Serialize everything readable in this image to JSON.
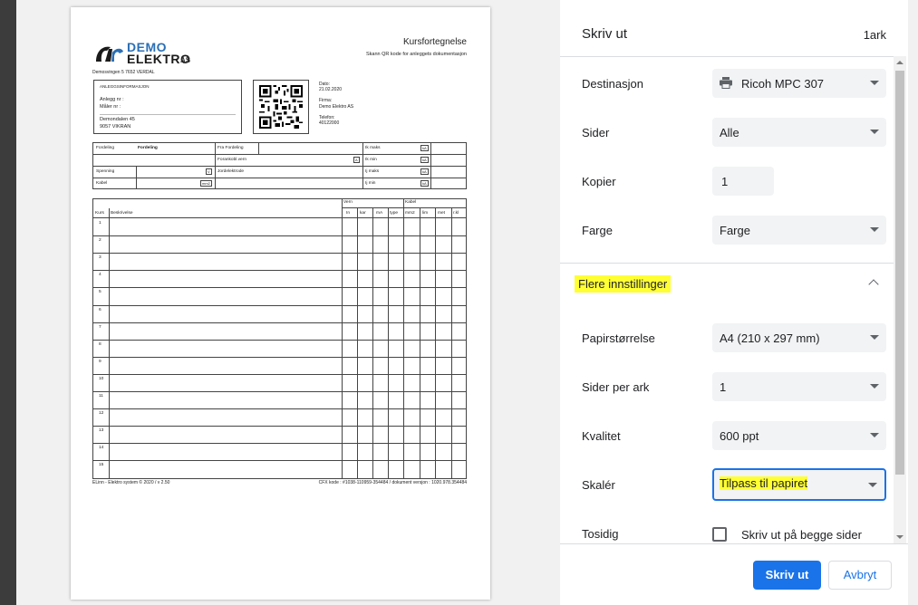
{
  "preview": {
    "company": {
      "line1": "DEMO",
      "line2": "ELEKTRO",
      "suffix": "AS"
    },
    "address": "Demosvingen 5 7652 VERDAL",
    "title": "Kursfortegnelse",
    "subtitle": "Skann QR kode for anleggets dokumentasjon",
    "anlegg": {
      "heading": "ANLEGGSINFORMASJON",
      "anlegg_nr": "Anlegg nr :",
      "maler_nr": "Måler nr :",
      "street": "Demondalen 45",
      "city": "9057 VIKRAN"
    },
    "info": {
      "dato_label": "Dato:",
      "dato": "21.02.2020",
      "firma_label": "Firma:",
      "firma": "Demo Elektro AS",
      "telefon_label": "Telefon:",
      "telefon": "40122000"
    },
    "fordeling": {
      "fordeling_label": "Fordeling",
      "fordeling_value": "Fordeling",
      "fra_fordeling": "Fra Fordeling",
      "forankobl_vern": "Forankobl.vern",
      "spenning": "Spenning",
      "kabel": "Kabel",
      "jordelektrode": "Jordelektrode",
      "ik_maks": "Ik maks",
      "ik_min": "Ik min",
      "ij_maks": "Ij maks",
      "ij_min": "Ij min",
      "unit_ka": "kA",
      "unit_a": "A",
      "unit_v": "V",
      "unit_mm2": "mm2"
    },
    "kurs_table": {
      "group_vern": "Vern",
      "group_kabel": "Kabel",
      "headers": [
        "Kurs",
        "Beskrivelse",
        "In",
        "kar",
        "mA",
        "type",
        "mm2",
        "lim",
        "met",
        "r.kl"
      ],
      "rows": [
        "1",
        "2",
        "3",
        "4",
        "5",
        "6",
        "7",
        "8",
        "9",
        "10",
        "11",
        "12",
        "13",
        "14",
        "15"
      ]
    },
    "footer_left": "ELinn - Elektro system © 2020 / v 2.50",
    "footer_right": "CFX kode : #1038-110959-354484 / dokument versjon : 1020.978.354484"
  },
  "panel": {
    "title": "Skriv ut",
    "sheet_count": "1ark",
    "destination": {
      "label": "Destinasjon",
      "value": "Ricoh MPC 307",
      "icon": "printer-icon"
    },
    "pages": {
      "label": "Sider",
      "value": "Alle"
    },
    "copies": {
      "label": "Kopier",
      "value": "1"
    },
    "color": {
      "label": "Farge",
      "value": "Farge"
    },
    "more_settings": "Flere innstillinger",
    "paper_size": {
      "label": "Papirstørrelse",
      "value": "A4 (210 x 297 mm)"
    },
    "pages_per_sheet": {
      "label": "Sider per ark",
      "value": "1"
    },
    "quality": {
      "label": "Kvalitet",
      "value": "600 ppt"
    },
    "scale": {
      "label": "Skalér",
      "value": "Tilpass til papiret"
    },
    "duplex": {
      "label": "Tosidig",
      "checkbox_label": "Skriv ut på begge sider",
      "checked": false
    },
    "print_button": "Skriv ut",
    "cancel_button": "Avbryt",
    "highlight_color": "#ffff33",
    "accent_color": "#1a73e8"
  }
}
